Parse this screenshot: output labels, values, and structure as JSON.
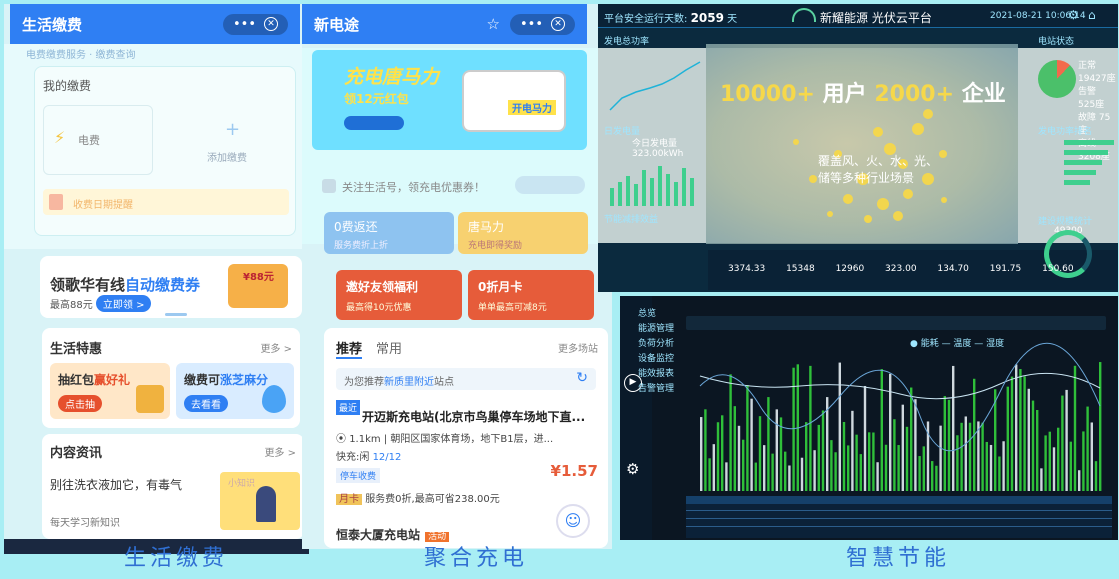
{
  "labels": [
    "生活缴费",
    "聚合充电",
    "智慧节能"
  ],
  "life": {
    "title": "生活缴费",
    "faded_banner": "电费缴费服务 · 缴费查询",
    "my_payments": "我的缴费",
    "electricity": "电费",
    "add_payment": "添加缴费",
    "reminder": "收费日期提醒",
    "ad": {
      "title_prefix": "领歌华有线",
      "title_highlight": "自动缴费券",
      "subtitle": "最高88元",
      "button": "立即领 >",
      "badge": "¥88元"
    },
    "deals": {
      "title": "生活特惠",
      "more": "更多 >",
      "left_title_a": "抽红包",
      "left_title_b": "赢好礼",
      "left_btn": "点击抽",
      "right_title_a": "缴费可",
      "right_title_b": "涨芝麻分",
      "right_btn": "去看看"
    },
    "news": {
      "title": "内容资讯",
      "more": "更多 >",
      "headline": "别往洗衣液加它，有毒气",
      "source": "每天学习新知识",
      "thumb_tag": "小知识"
    }
  },
  "ev": {
    "title": "新电途",
    "promo": {
      "title": "充电唐马力",
      "subtitle": "领12元红包",
      "sign": "开电马力"
    },
    "follow": "关注生活号，领充电优惠券！",
    "tiles": [
      {
        "title": "0费返还",
        "sub": "服务费折上折"
      },
      {
        "title": "唐马力",
        "sub": "充电即得奖励"
      },
      {
        "title": "邀好友领福利",
        "sub": "最高得10元优惠"
      },
      {
        "title": "0折月卡",
        "sub": "单单最高可减8元"
      }
    ],
    "tabs": [
      "推荐",
      "常用"
    ],
    "more_stations": "更多场站",
    "location_prefix": "为您推荐",
    "location_place": "新质里附近",
    "location_suffix": "站点",
    "station": {
      "ribbon": "最近",
      "name": "开迈斯充电站(北京市鸟巢停车场地下直...",
      "distance": "1.1km",
      "address": "朝阳区国家体育场，地下B1层，进...",
      "fast_label": "快充:闲",
      "fast_count": "12/12",
      "parking": "停车收费",
      "price": "¥1.57",
      "card_tag": "月卡",
      "card_text": "服务费0折,最高可省238.00元"
    },
    "station2": {
      "name": "恒泰大厦充电站",
      "tag": "活动"
    }
  },
  "dash": {
    "safe_label": "平台安全运行天数:",
    "safe_days": "2059",
    "safe_unit": "天",
    "brand": "新耀能源",
    "platform": "光伏云平台",
    "datetime": "2021-08-21 10:06:14",
    "map_users": "10000+",
    "map_users_unit": "用户",
    "map_enterprises": "2000+",
    "map_enterprises_unit": "企业",
    "map_sub1": "覆盖风、火、水、光、",
    "map_sub2": "储等多种行业场景",
    "left1_title": "发电总功率",
    "left2_title": "日发电量",
    "today_gen": "今日发电量323.00kWh",
    "left3_title": "节能减排效益",
    "right1_title": "电站状态",
    "stats": [
      "正常 19427座",
      "告警 525座",
      "故障 75座",
      "离线 3208座"
    ],
    "right2_title": "发电功率排名",
    "right3_title": "建设规模统计",
    "right3_val": "49300",
    "kpis": "3374.33 15348 12960 323.00 134.70 191.75 150.60"
  },
  "trend": {
    "menu": [
      "总览",
      "能源管理",
      "负荷分析",
      "设备监控",
      "能效报表",
      "告警管理"
    ],
    "legend": "● 能耗 — 温度 — 湿度"
  }
}
